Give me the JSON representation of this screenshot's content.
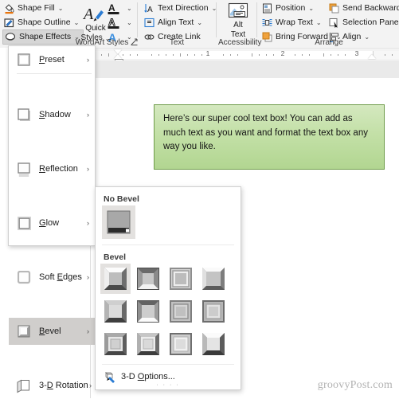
{
  "ribbon": {
    "groups": [
      {
        "label": "WordArt Styles"
      },
      {
        "label": "Text"
      },
      {
        "label": "Accessibility"
      },
      {
        "label": "Arrange"
      }
    ],
    "shape_commands": [
      {
        "label": "Shape Fill",
        "icon": "paint-bucket-icon",
        "arrow": "⌄"
      },
      {
        "label": "Shape Outline",
        "icon": "pen-outline-icon",
        "arrow": "⌄"
      },
      {
        "label": "Shape Effects",
        "icon": "shape-effects-icon",
        "arrow": "⌄"
      }
    ],
    "quick_styles": {
      "line1": "Quick",
      "line2": "Styles",
      "arrow": "⌄",
      "icon": "wordart-quick-styles-icon"
    },
    "wordart_buttons": [
      {
        "glyph": "A",
        "name": "text-fill-icon",
        "arrow": "⌄"
      },
      {
        "glyph": "A",
        "name": "text-outline-icon",
        "arrow": "⌄"
      },
      {
        "glyph": "A",
        "name": "text-effects-icon",
        "arrow": "⌄"
      }
    ],
    "text_commands": [
      {
        "label": "Text Direction",
        "icon": "text-direction-icon",
        "arrow": "⌄"
      },
      {
        "label": "Align Text",
        "icon": "align-text-icon",
        "arrow": "⌄"
      },
      {
        "label": "Create Link",
        "icon": "create-link-icon",
        "arrow": ""
      }
    ],
    "alt_text": {
      "line1": "Alt",
      "line2": "Text",
      "icon": "alt-text-icon"
    },
    "arrange_left": [
      {
        "label": "Position",
        "icon": "position-icon",
        "arrow": "⌄"
      },
      {
        "label": "Wrap Text",
        "icon": "wrap-text-icon",
        "arrow": "⌄"
      },
      {
        "label": "Bring Forward",
        "icon": "bring-forward-icon",
        "arrow": "⌄"
      }
    ],
    "arrange_right": [
      {
        "label": "Send Backward",
        "icon": "send-backward-icon",
        "arrow": "⌄"
      },
      {
        "label": "Selection Pane",
        "icon": "selection-pane-icon",
        "arrow": ""
      },
      {
        "label": "Align",
        "icon": "align-objects-icon",
        "arrow": "⌄"
      }
    ],
    "dialog_launcher": "↗"
  },
  "ruler": {
    "numbers": [
      "1",
      "2",
      "3"
    ]
  },
  "document": {
    "textbox_text": "Here’s our super cool text box! You can add as much text as you want and format the text box any way you like.",
    "textbox_fill_top": "#d4e8bf",
    "textbox_fill_bottom": "#b2d691",
    "textbox_border": "#6f9c4a",
    "watermark": "groovyPost.com"
  },
  "effects_menu": {
    "items": [
      {
        "label": "Preset",
        "accel": "P",
        "icon": "preset-icon",
        "chevron": "›",
        "selected": false
      },
      {
        "label": "Shadow",
        "accel": "S",
        "icon": "shadow-icon",
        "chevron": "›",
        "selected": false
      },
      {
        "label": "Reflection",
        "accel": "R",
        "icon": "reflection-icon",
        "chevron": "›",
        "selected": false
      },
      {
        "label": "Glow",
        "accel": "G",
        "icon": "glow-icon",
        "chevron": "›",
        "selected": false
      },
      {
        "label": "Soft Edges",
        "accel": "E",
        "icon": "soft-edges-icon",
        "chevron": "›",
        "selected": false
      },
      {
        "label": "Bevel",
        "accel": "B",
        "icon": "bevel-icon",
        "chevron": "›",
        "selected": true
      },
      {
        "label": "3-D Rotation",
        "accel": "D",
        "icon": "rotation-3d-icon",
        "chevron": "›",
        "selected": false
      }
    ]
  },
  "bevel_gallery": {
    "no_bevel_heading": "No Bevel",
    "bevel_heading": "Bevel",
    "no_bevel_cell": {
      "name": "no-bevel-thumbnail",
      "selected": true
    },
    "bevel_cells": [
      {
        "name": "bevel-circle",
        "selected": true
      },
      {
        "name": "bevel-relaxed-inset",
        "selected": false
      },
      {
        "name": "bevel-cross",
        "selected": false
      },
      {
        "name": "bevel-cool-slant",
        "selected": false
      },
      {
        "name": "bevel-angle",
        "selected": false
      },
      {
        "name": "bevel-soft-round",
        "selected": false
      },
      {
        "name": "bevel-convex",
        "selected": false
      },
      {
        "name": "bevel-slope",
        "selected": false
      },
      {
        "name": "bevel-divot",
        "selected": false
      },
      {
        "name": "bevel-riblet",
        "selected": false
      },
      {
        "name": "bevel-hard-edge",
        "selected": false
      },
      {
        "name": "bevel-art-deco",
        "selected": false
      }
    ],
    "options": {
      "label": "3-D Options...",
      "accel": "O",
      "icon": "three-d-options-icon"
    },
    "resize_dots": "· · · ·"
  }
}
